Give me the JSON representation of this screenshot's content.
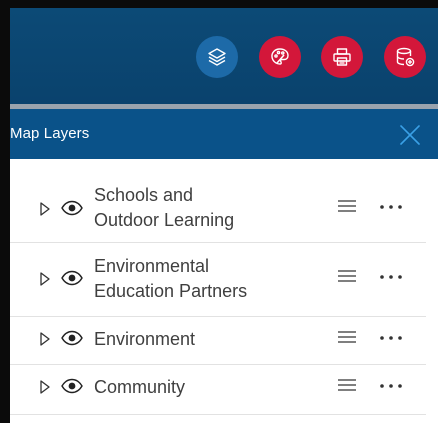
{
  "toolbar": {
    "buttons": [
      {
        "icon": "layers-icon",
        "color": "#1d6aa8"
      },
      {
        "icon": "palette-icon",
        "color": "#d3173a"
      },
      {
        "icon": "print-icon",
        "color": "#d3173a"
      },
      {
        "icon": "database-add-icon",
        "color": "#d3173a"
      }
    ]
  },
  "panel": {
    "title": "Map Layers",
    "close_icon": "close-icon",
    "header_color": "#0a5289"
  },
  "layers": [
    {
      "line1": "Schools and",
      "line2": "Outdoor Learning"
    },
    {
      "line1": "Environmental",
      "line2": "Education Partners"
    },
    {
      "line1": "Environment",
      "line2": ""
    },
    {
      "line1": "Community",
      "line2": ""
    }
  ]
}
